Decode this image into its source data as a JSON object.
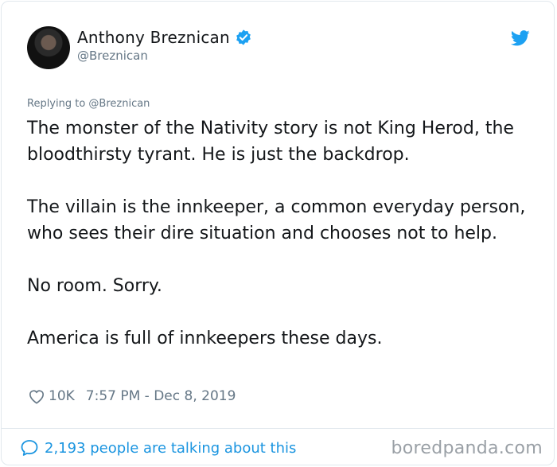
{
  "tweet": {
    "author_name": "Anthony Breznican",
    "author_handle": "@Breznican",
    "replying_to": "Replying to @Breznican",
    "paragraphs": [
      "The monster of the Nativity story is not King Herod, the bloodthirsty tyrant. He is just the backdrop.",
      "The villain is the innkeeper, a common everyday person, who sees their dire situation and chooses not to help.",
      "No room. Sorry.",
      "America is full of innkeepers these days."
    ],
    "likes": "10K",
    "timestamp": "7:57 PM - Dec 8, 2019",
    "talking": "2,193 people are talking about this"
  },
  "watermark": "boredpanda.com",
  "colors": {
    "accent": "#1da1f2",
    "link": "#1b95e0",
    "muted": "#657786",
    "border": "#e1e8ed"
  },
  "icons": [
    "verified-badge-icon",
    "twitter-bird-icon",
    "heart-icon",
    "speech-bubble-icon"
  ]
}
